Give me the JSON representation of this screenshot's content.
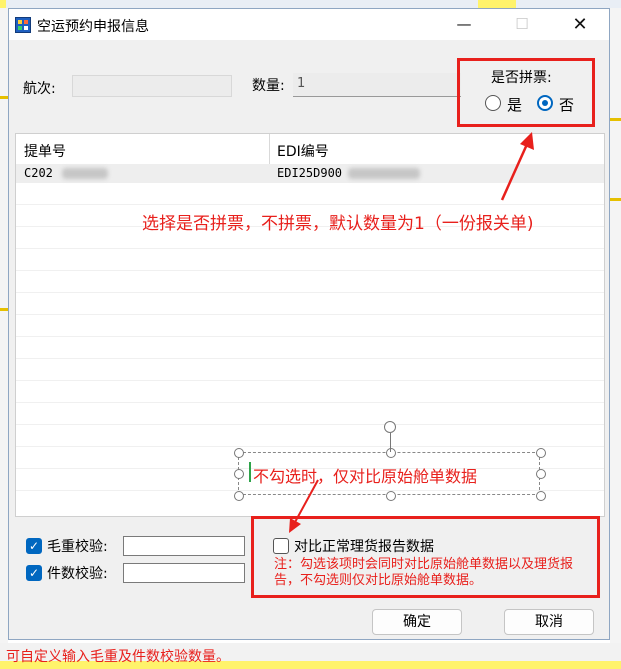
{
  "window": {
    "title": "空运预约申报信息",
    "minimize": "—",
    "maximize": "☐",
    "close": "✕"
  },
  "form": {
    "voyage_label": "航次:",
    "voyage_value": "",
    "quantity_label": "数量:",
    "quantity_value": "1",
    "split_group": {
      "title": "是否拼票:",
      "options": [
        "是",
        "否"
      ],
      "selected": "否"
    }
  },
  "table": {
    "columns": [
      "提单号",
      "EDI编号"
    ],
    "rows": [
      {
        "bill_no": "C202",
        "edi_no": "EDI25D900"
      }
    ]
  },
  "annotations": {
    "split_note": "选择是否拼票，不拼票，默认数量为1（一份报关单)",
    "unchecked_note": "不勾选时，仅对比原始舱单数据",
    "compare_note": "注：勾选该项时会同时对比原始舱单数据以及理货报告，不勾选则仅对比原始舱单数据。",
    "custom_note": "可自定义输入毛重及件数校验数量。"
  },
  "checks": {
    "gross_weight": {
      "label": "毛重校验:",
      "checked": true,
      "value": ""
    },
    "piece_count": {
      "label": "件数校验:",
      "checked": true,
      "value": ""
    },
    "compare_tally": {
      "label": "对比正常理货报告数据",
      "checked": false
    }
  },
  "buttons": {
    "ok": "确定",
    "cancel": "取消"
  },
  "colors": {
    "annotation_red": "#e8201c",
    "accent_blue": "#0067c0"
  }
}
